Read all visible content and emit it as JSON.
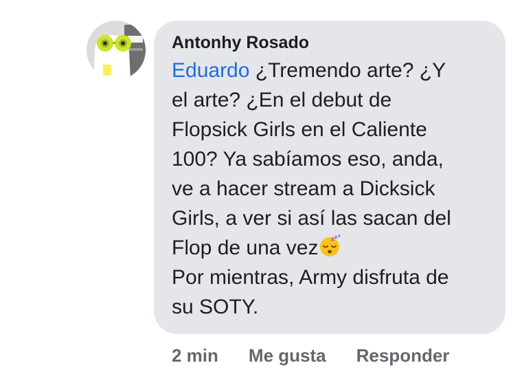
{
  "comment": {
    "author": "Antonhy Rosado",
    "mention": "Eduardo",
    "lines": [
      " ¿Tremendo arte? ¿Y",
      "el arte? ¿En el debut de",
      "Flopsick Girls en el Caliente",
      "100? Ya sabíamos eso, anda,",
      "ve a hacer stream a Dicksick",
      "Girls, a ver si así las sacan del",
      "Flop de una vez",
      "Por mientras, Army disfruta de",
      "su SOTY."
    ],
    "emoji": "sleeping-face-icon"
  },
  "actions": {
    "time": "2 min",
    "like": "Me gusta",
    "reply": "Responder"
  },
  "colors": {
    "bubble": "#e4e6ea",
    "mention": "#1d6ee0",
    "meta": "#65676b"
  }
}
